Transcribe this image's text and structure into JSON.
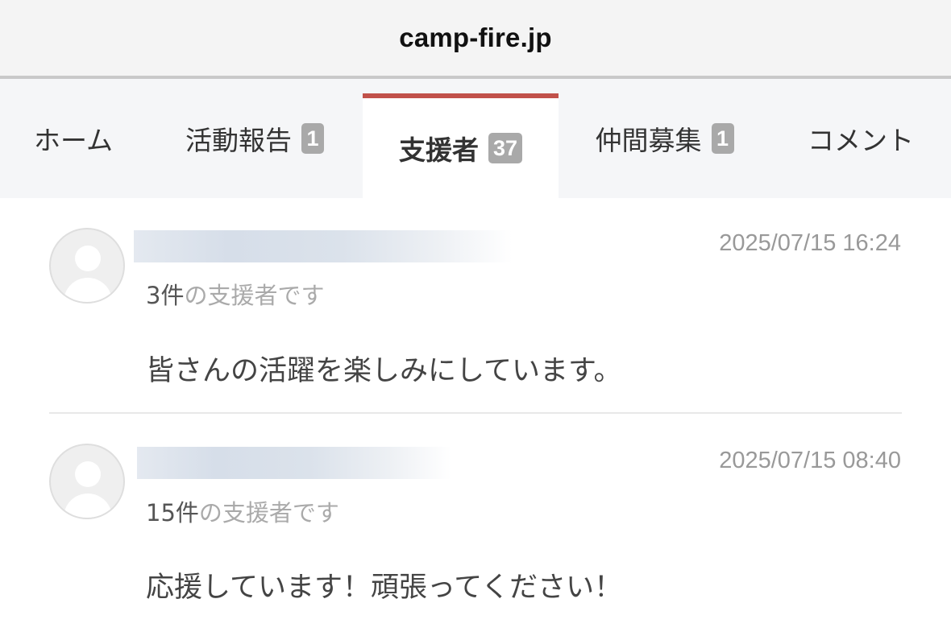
{
  "browser": {
    "url": "camp-fire.jp"
  },
  "tabs": [
    {
      "label": "ホーム",
      "badge": null
    },
    {
      "label": "活動報告",
      "badge": "1"
    },
    {
      "label": "支援者",
      "badge": "37",
      "active": true
    },
    {
      "label": "仲間募集",
      "badge": "1"
    },
    {
      "label": "コメント",
      "badge": null
    }
  ],
  "supporters": [
    {
      "avatar_icon": "default-user-icon",
      "date": "2025/07/15 16:24",
      "count_number": "3件",
      "count_suffix": "の支援者です",
      "message": "皆さんの活躍を楽しみにしています。"
    },
    {
      "avatar_icon": "default-user-icon",
      "date": "2025/07/15 08:40",
      "count_number": "15件",
      "count_suffix": "の支援者です",
      "message": "応援しています！頑張ってください！"
    }
  ],
  "colors": {
    "active_tab_accent": "#c1514a",
    "badge_bg": "#a9a9a9",
    "tab_bar_bg": "#f5f6f8"
  }
}
